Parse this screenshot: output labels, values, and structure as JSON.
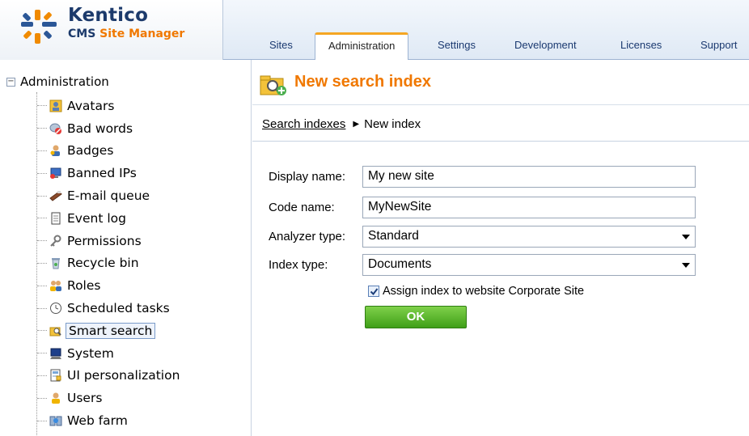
{
  "app": {
    "brand": "Kentico",
    "subtitle_part1": "CMS",
    "subtitle_part2": "Site Manager"
  },
  "tabs": [
    {
      "label": "Sites",
      "active": false
    },
    {
      "label": "Administration",
      "active": true
    },
    {
      "label": "Settings",
      "active": false
    },
    {
      "label": "Development",
      "active": false
    },
    {
      "label": "Licenses",
      "active": false
    },
    {
      "label": "Support",
      "active": false
    }
  ],
  "tree": {
    "root_label": "Administration",
    "expander": "−",
    "items": [
      {
        "label": "Avatars",
        "icon": "avatar-icon"
      },
      {
        "label": "Bad words",
        "icon": "bad-words-icon"
      },
      {
        "label": "Badges",
        "icon": "badges-icon"
      },
      {
        "label": "Banned IPs",
        "icon": "banned-ips-icon"
      },
      {
        "label": "E-mail queue",
        "icon": "email-queue-icon"
      },
      {
        "label": "Event log",
        "icon": "event-log-icon"
      },
      {
        "label": "Permissions",
        "icon": "permissions-icon"
      },
      {
        "label": "Recycle bin",
        "icon": "recycle-bin-icon"
      },
      {
        "label": "Roles",
        "icon": "roles-icon"
      },
      {
        "label": "Scheduled tasks",
        "icon": "scheduled-tasks-icon"
      },
      {
        "label": "Smart search",
        "icon": "smart-search-icon",
        "selected": true
      },
      {
        "label": "System",
        "icon": "system-icon"
      },
      {
        "label": "UI personalization",
        "icon": "ui-personalization-icon"
      },
      {
        "label": "Users",
        "icon": "users-icon"
      },
      {
        "label": "Web farm",
        "icon": "web-farm-icon"
      }
    ]
  },
  "page": {
    "title": "New search index",
    "breadcrumb_link": "Search indexes",
    "breadcrumb_current": "New index"
  },
  "form": {
    "display_name_label": "Display name:",
    "display_name_value": "My new site",
    "code_name_label": "Code name:",
    "code_name_value": "MyNewSite",
    "analyzer_label": "Analyzer type:",
    "analyzer_value": "Standard",
    "index_type_label": "Index type:",
    "index_type_value": "Documents",
    "assign_label": "Assign index to website Corporate Site",
    "assign_checked": true,
    "ok_label": "OK"
  },
  "colors": {
    "accent_orange": "#f07800",
    "brand_navy": "#1c3a6b",
    "ok_green": "#4caf1f"
  }
}
